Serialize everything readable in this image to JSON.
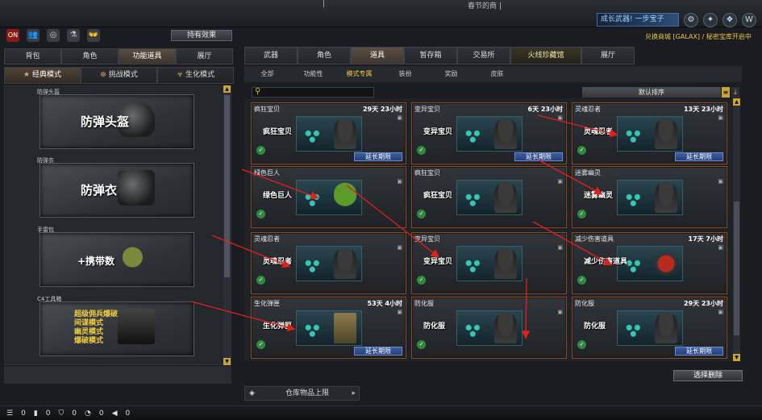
{
  "topbar": {
    "ticker_left": "|",
    "ticker_right": "春节的商 |"
  },
  "top_icons": [
    "ON",
    "👥",
    "◎",
    "⚗",
    "👐"
  ],
  "growth_badge": "成长武器! 一步宝子",
  "right_icons": [
    "⚙",
    "✦",
    "❖",
    "W"
  ],
  "gold_note": "兑换商城 [GALAX] / 秘密宝库开启中",
  "effect_button": "持有效果",
  "left_tabs": [
    "背包",
    "角色",
    "功能道具",
    "展厅"
  ],
  "mode_tabs": [
    {
      "icon": "★",
      "label": "经典模式"
    },
    {
      "icon": "⊕",
      "label": "挑战模式"
    },
    {
      "icon": "☣",
      "label": "生化模式"
    }
  ],
  "categories": [
    {
      "tag": "防弹头盔",
      "title": "防弹头盔"
    },
    {
      "tag": "防弹衣",
      "title": "防弹衣"
    },
    {
      "tag": "手雷包",
      "title": "+携带数"
    },
    {
      "tag": "C4工具箱",
      "lines": [
        "超级佣兵爆破",
        "间谍模式",
        "幽灵模式",
        "爆破模式"
      ]
    }
  ],
  "main_tabs": [
    "武器",
    "角色",
    "道具",
    "暂存箱",
    "交易所",
    "火线珍藏馆",
    "展厅"
  ],
  "sub_tabs": [
    "全部",
    "功能性",
    "模式专属",
    "装扮",
    "奖励",
    "皮肤"
  ],
  "sort_label": "默认排序",
  "items": [
    {
      "name": "疯狂宝贝",
      "days": "29天 23小时",
      "label": "疯狂宝贝",
      "extend": "延长期限",
      "style": "dark"
    },
    {
      "name": "变异宝贝",
      "days": "6天 23小时",
      "label": "变异宝贝",
      "extend": "延长期限",
      "style": "dark"
    },
    {
      "name": "灵魂忍者",
      "days": "13天 23小时",
      "label": "灵魂忍者",
      "extend": "延长期限",
      "style": "dark"
    },
    {
      "name": "绿色巨人",
      "days": "",
      "label": "绿色巨人",
      "extend": "",
      "style": "green"
    },
    {
      "name": "疯狂宝贝",
      "days": "",
      "label": "疯狂宝贝",
      "extend": "",
      "style": "dark"
    },
    {
      "name": "迷雾幽灵",
      "days": "",
      "label": "迷雾幽灵",
      "extend": "",
      "style": "dark"
    },
    {
      "name": "灵魂忍者",
      "days": "",
      "label": "灵魂忍者",
      "extend": "",
      "style": "dark"
    },
    {
      "name": "变异宝贝",
      "days": "",
      "label": "变异宝贝",
      "extend": "",
      "style": "dark"
    },
    {
      "name": "减少伤害道具",
      "days": "17天 7小时",
      "label": "减少伤害道具",
      "extend": "",
      "style": "red"
    },
    {
      "name": "生化弹匣",
      "days": "53天 4小时",
      "label": "生化弹匣",
      "extend": "延长期限",
      "style": "box"
    },
    {
      "name": "防化服",
      "days": "",
      "label": "防化服",
      "extend": "",
      "style": "dark"
    },
    {
      "name": "防化服",
      "days": "29天 23小时",
      "label": "防化服",
      "extend": "延长期限",
      "style": "dark"
    }
  ],
  "bulk_delete": "选择删除",
  "storage_label": "仓库物品上限",
  "bottom_bar": [
    "0",
    "0",
    "0",
    "0",
    "0",
    "0"
  ]
}
